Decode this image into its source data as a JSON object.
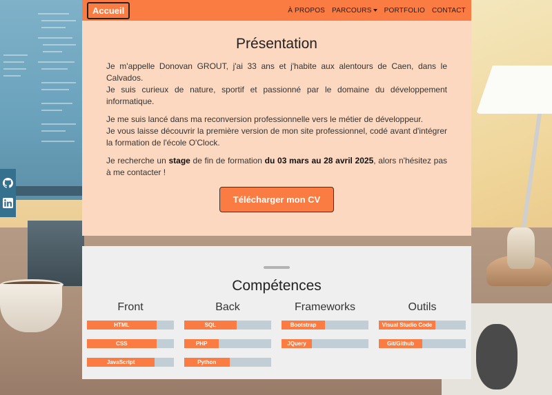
{
  "navbar": {
    "brand": "Accueil",
    "links": [
      "À PROPOS",
      "PARCOURS",
      "PORTFOLIO",
      "CONTACT"
    ]
  },
  "social": {
    "items": [
      {
        "icon": "github-icon"
      },
      {
        "icon": "linkedin-icon"
      }
    ]
  },
  "presentation": {
    "title": "Présentation",
    "p1_line1": "Je m'appelle Donovan GROUT, j'ai 33 ans et j'habite aux alentours de Caen, dans le Calvados.",
    "p1_line2": "Je suis curieux de nature, sportif et passionné par le domaine du développement informatique.",
    "p2_line1": "Je me suis lancé dans ma reconversion professionnelle vers le métier de développeur.",
    "p2_line2": "Je vous laisse découvrir la première version de mon site professionnel, codé avant d'intégrer la formation de l'école O'Clock.",
    "p3_part1": "Je recherche un ",
    "p3_bold1": "stage",
    "p3_part2": " de fin de formation ",
    "p3_bold2": "du 03 mars au 28 avril 2025",
    "p3_part3": ", alors n'hésitez pas à me contacter !",
    "cv_button": "Télécharger mon CV"
  },
  "competences": {
    "title": "Compétences",
    "columns": [
      {
        "title": "Front",
        "skills": [
          {
            "name": "HTML",
            "level": 0.8
          },
          {
            "name": "CSS",
            "level": 0.8
          },
          {
            "name": "JavaScript",
            "level": 0.78
          }
        ]
      },
      {
        "title": "Back",
        "skills": [
          {
            "name": "SQL",
            "level": 0.6
          },
          {
            "name": "PHP",
            "level": 0.4
          },
          {
            "name": "Python",
            "level": 0.52
          }
        ]
      },
      {
        "title": "Frameworks",
        "skills": [
          {
            "name": "Bootstrap",
            "level": 0.5
          },
          {
            "name": "JQuery",
            "level": 0.35
          }
        ]
      },
      {
        "title": "Outils",
        "skills": [
          {
            "name": "Visual Studio Code",
            "level": 0.65
          },
          {
            "name": "Git/Github",
            "level": 0.5
          }
        ]
      }
    ]
  },
  "colors": {
    "accent": "#fb7c43",
    "presentation_bg": "#fdd8c0",
    "competences_bg": "#efefef",
    "skill_track": "#c1ced6",
    "social_bg": "#36708f"
  }
}
